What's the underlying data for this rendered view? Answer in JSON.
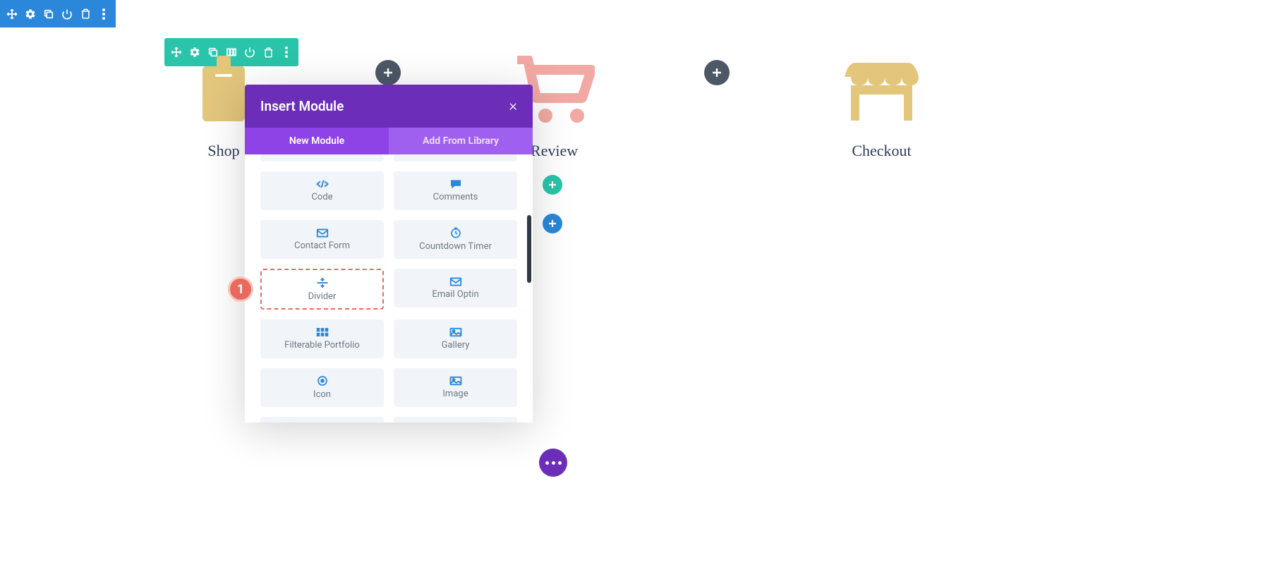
{
  "columns": {
    "shop": {
      "label": "Shop"
    },
    "review": {
      "label": "Review"
    },
    "checkout": {
      "label": "Checkout"
    }
  },
  "modal": {
    "title": "Insert Module",
    "tabs": {
      "new": "New Module",
      "library": "Add From Library"
    },
    "modules": {
      "code": "Code",
      "comments": "Comments",
      "contact_form": "Contact Form",
      "countdown": "Countdown Timer",
      "divider": "Divider",
      "email_optin": "Email Optin",
      "filterable_portfolio": "Filterable Portfolio",
      "gallery": "Gallery",
      "icon": "Icon",
      "image": "Image"
    }
  },
  "callout": {
    "number": "1"
  }
}
